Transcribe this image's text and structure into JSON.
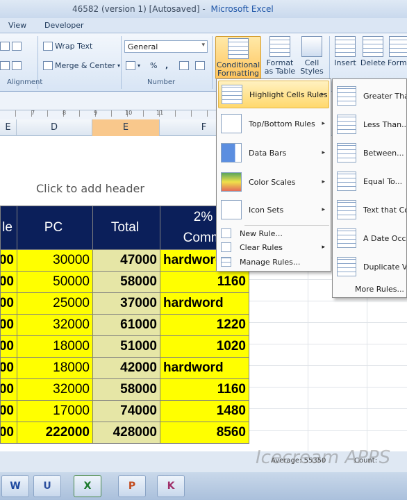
{
  "window": {
    "title": "46582 (version 1) [Autosaved]",
    "app": "Microsoft Excel"
  },
  "tabs": [
    "View",
    "Developer"
  ],
  "ribbon": {
    "wrap_text": "Wrap Text",
    "merge_center": "Merge & Center",
    "alignment_label": "Alignment",
    "number_format": "General",
    "percent": "%",
    "comma": ",",
    "number_label": "Number",
    "conditional_formatting": [
      "Conditional",
      "Formatting"
    ],
    "format_as_table": [
      "Format",
      "as Table"
    ],
    "cell_styles": [
      "Cell",
      "Styles"
    ],
    "insert": "Insert",
    "delete": "Delete",
    "format": "Forma"
  },
  "ruler_marks": [
    "7",
    "8",
    "9",
    "10",
    "11"
  ],
  "columns": [
    "E",
    "D",
    "E",
    "F"
  ],
  "page_header_prompt": "Click to add header",
  "table": {
    "headers": [
      "le",
      "PC",
      "Total",
      "2%",
      "Commis"
    ],
    "rows": [
      [
        "00",
        "30000",
        "47000",
        "hardword"
      ],
      [
        "00",
        "50000",
        "58000",
        "1160"
      ],
      [
        "00",
        "25000",
        "37000",
        "hardword"
      ],
      [
        "00",
        "32000",
        "61000",
        "1220"
      ],
      [
        "00",
        "18000",
        "51000",
        "1020"
      ],
      [
        "00",
        "18000",
        "42000",
        "hardword"
      ],
      [
        "00",
        "32000",
        "58000",
        "1160"
      ],
      [
        "00",
        "17000",
        "74000",
        "1480"
      ],
      [
        "00",
        "222000",
        "428000",
        "8560"
      ]
    ]
  },
  "cf_menu": {
    "items": [
      {
        "label": "Highlight Cells Rules",
        "highlighted": true
      },
      {
        "label": "Top/Bottom Rules"
      },
      {
        "label": "Data Bars"
      },
      {
        "label": "Color Scales"
      },
      {
        "label": "Icon Sets"
      }
    ],
    "small_items": [
      "New Rule...",
      "Clear Rules",
      "Manage Rules..."
    ]
  },
  "highlight_submenu": {
    "items": [
      "Greater Than...",
      "Less Than...",
      "Between...",
      "Equal To...",
      "Text that Con",
      "A Date Occurr",
      "Duplicate Valu"
    ],
    "more": "More Rules..."
  },
  "status": {
    "average": "Average: 55350",
    "count": "Count:"
  },
  "watermark": "Icecream APPS",
  "taskbar_items": [
    "W",
    "U",
    "X",
    "P",
    "K"
  ]
}
